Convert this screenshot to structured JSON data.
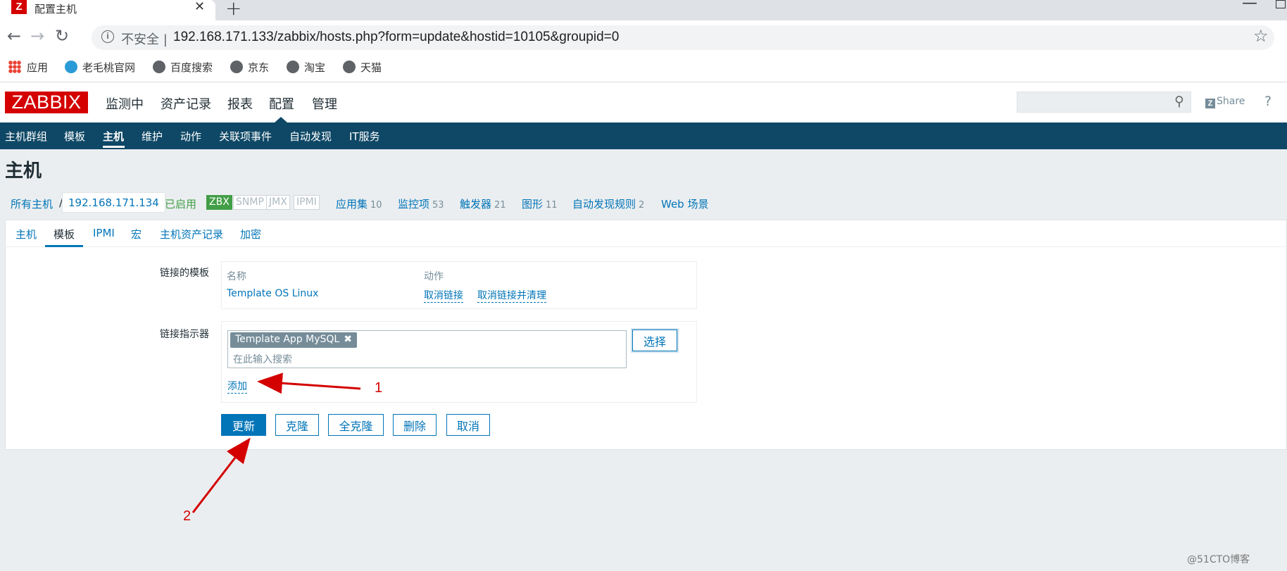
{
  "browser": {
    "tab_title": "配置主机",
    "tab_close": "✕",
    "new_tab": "+",
    "minimize": "—",
    "insecure_label": "不安全",
    "url": "192.168.171.133/zabbix/hosts.php?form=update&hostid=10105&groupid=0",
    "bookmarks": [
      "应用",
      "老毛桃官网",
      "百度搜索",
      "京东",
      "淘宝",
      "天猫"
    ]
  },
  "zabbix": {
    "logo": "ZABBIX",
    "main_menu": [
      "监测中",
      "资产记录",
      "报表",
      "配置",
      "管理"
    ],
    "share": "Share",
    "help": "?",
    "sub_menu": [
      "主机群组",
      "模板",
      "主机",
      "维护",
      "动作",
      "关联项事件",
      "自动发现",
      "IT服务"
    ],
    "page_title": "主机"
  },
  "breadcrumb": {
    "all_hosts": "所有主机",
    "separator": "/",
    "host": "192.168.171.134",
    "status": "已启用",
    "availability": [
      "ZBX",
      "SNMP",
      "JMX",
      "IPMI"
    ],
    "items": [
      {
        "label": "应用集",
        "count": "10"
      },
      {
        "label": "监控项",
        "count": "53"
      },
      {
        "label": "触发器",
        "count": "21"
      },
      {
        "label": "图形",
        "count": "11"
      },
      {
        "label": "自动发现规则",
        "count": "2"
      },
      {
        "label": "Web 场景",
        "count": ""
      }
    ]
  },
  "form_tabs": [
    "主机",
    "模板",
    "IPMI",
    "宏",
    "主机资产记录",
    "加密"
  ],
  "templates": {
    "linked_label": "链接的模板",
    "col_name": "名称",
    "col_action": "动作",
    "row_name": "Template OS Linux",
    "unlink": "取消链接",
    "unlink_clear": "取消链接并清理",
    "link_label": "链接指示器",
    "chip": "Template App MySQL",
    "chip_remove": "✖",
    "placeholder": "在此输入搜索",
    "select": "选择",
    "add": "添加"
  },
  "buttons": {
    "update": "更新",
    "clone": "克隆",
    "full_clone": "全克隆",
    "delete": "删除",
    "cancel": "取消"
  },
  "annotations": [
    "1",
    "2"
  ],
  "watermark": "@51CTO博客",
  "colors": {
    "zabbix_red": "#d40000",
    "nav_blue": "#0e4866",
    "link_blue": "#0275b8",
    "green": "#429e47",
    "annotation_red": "#d40000"
  }
}
